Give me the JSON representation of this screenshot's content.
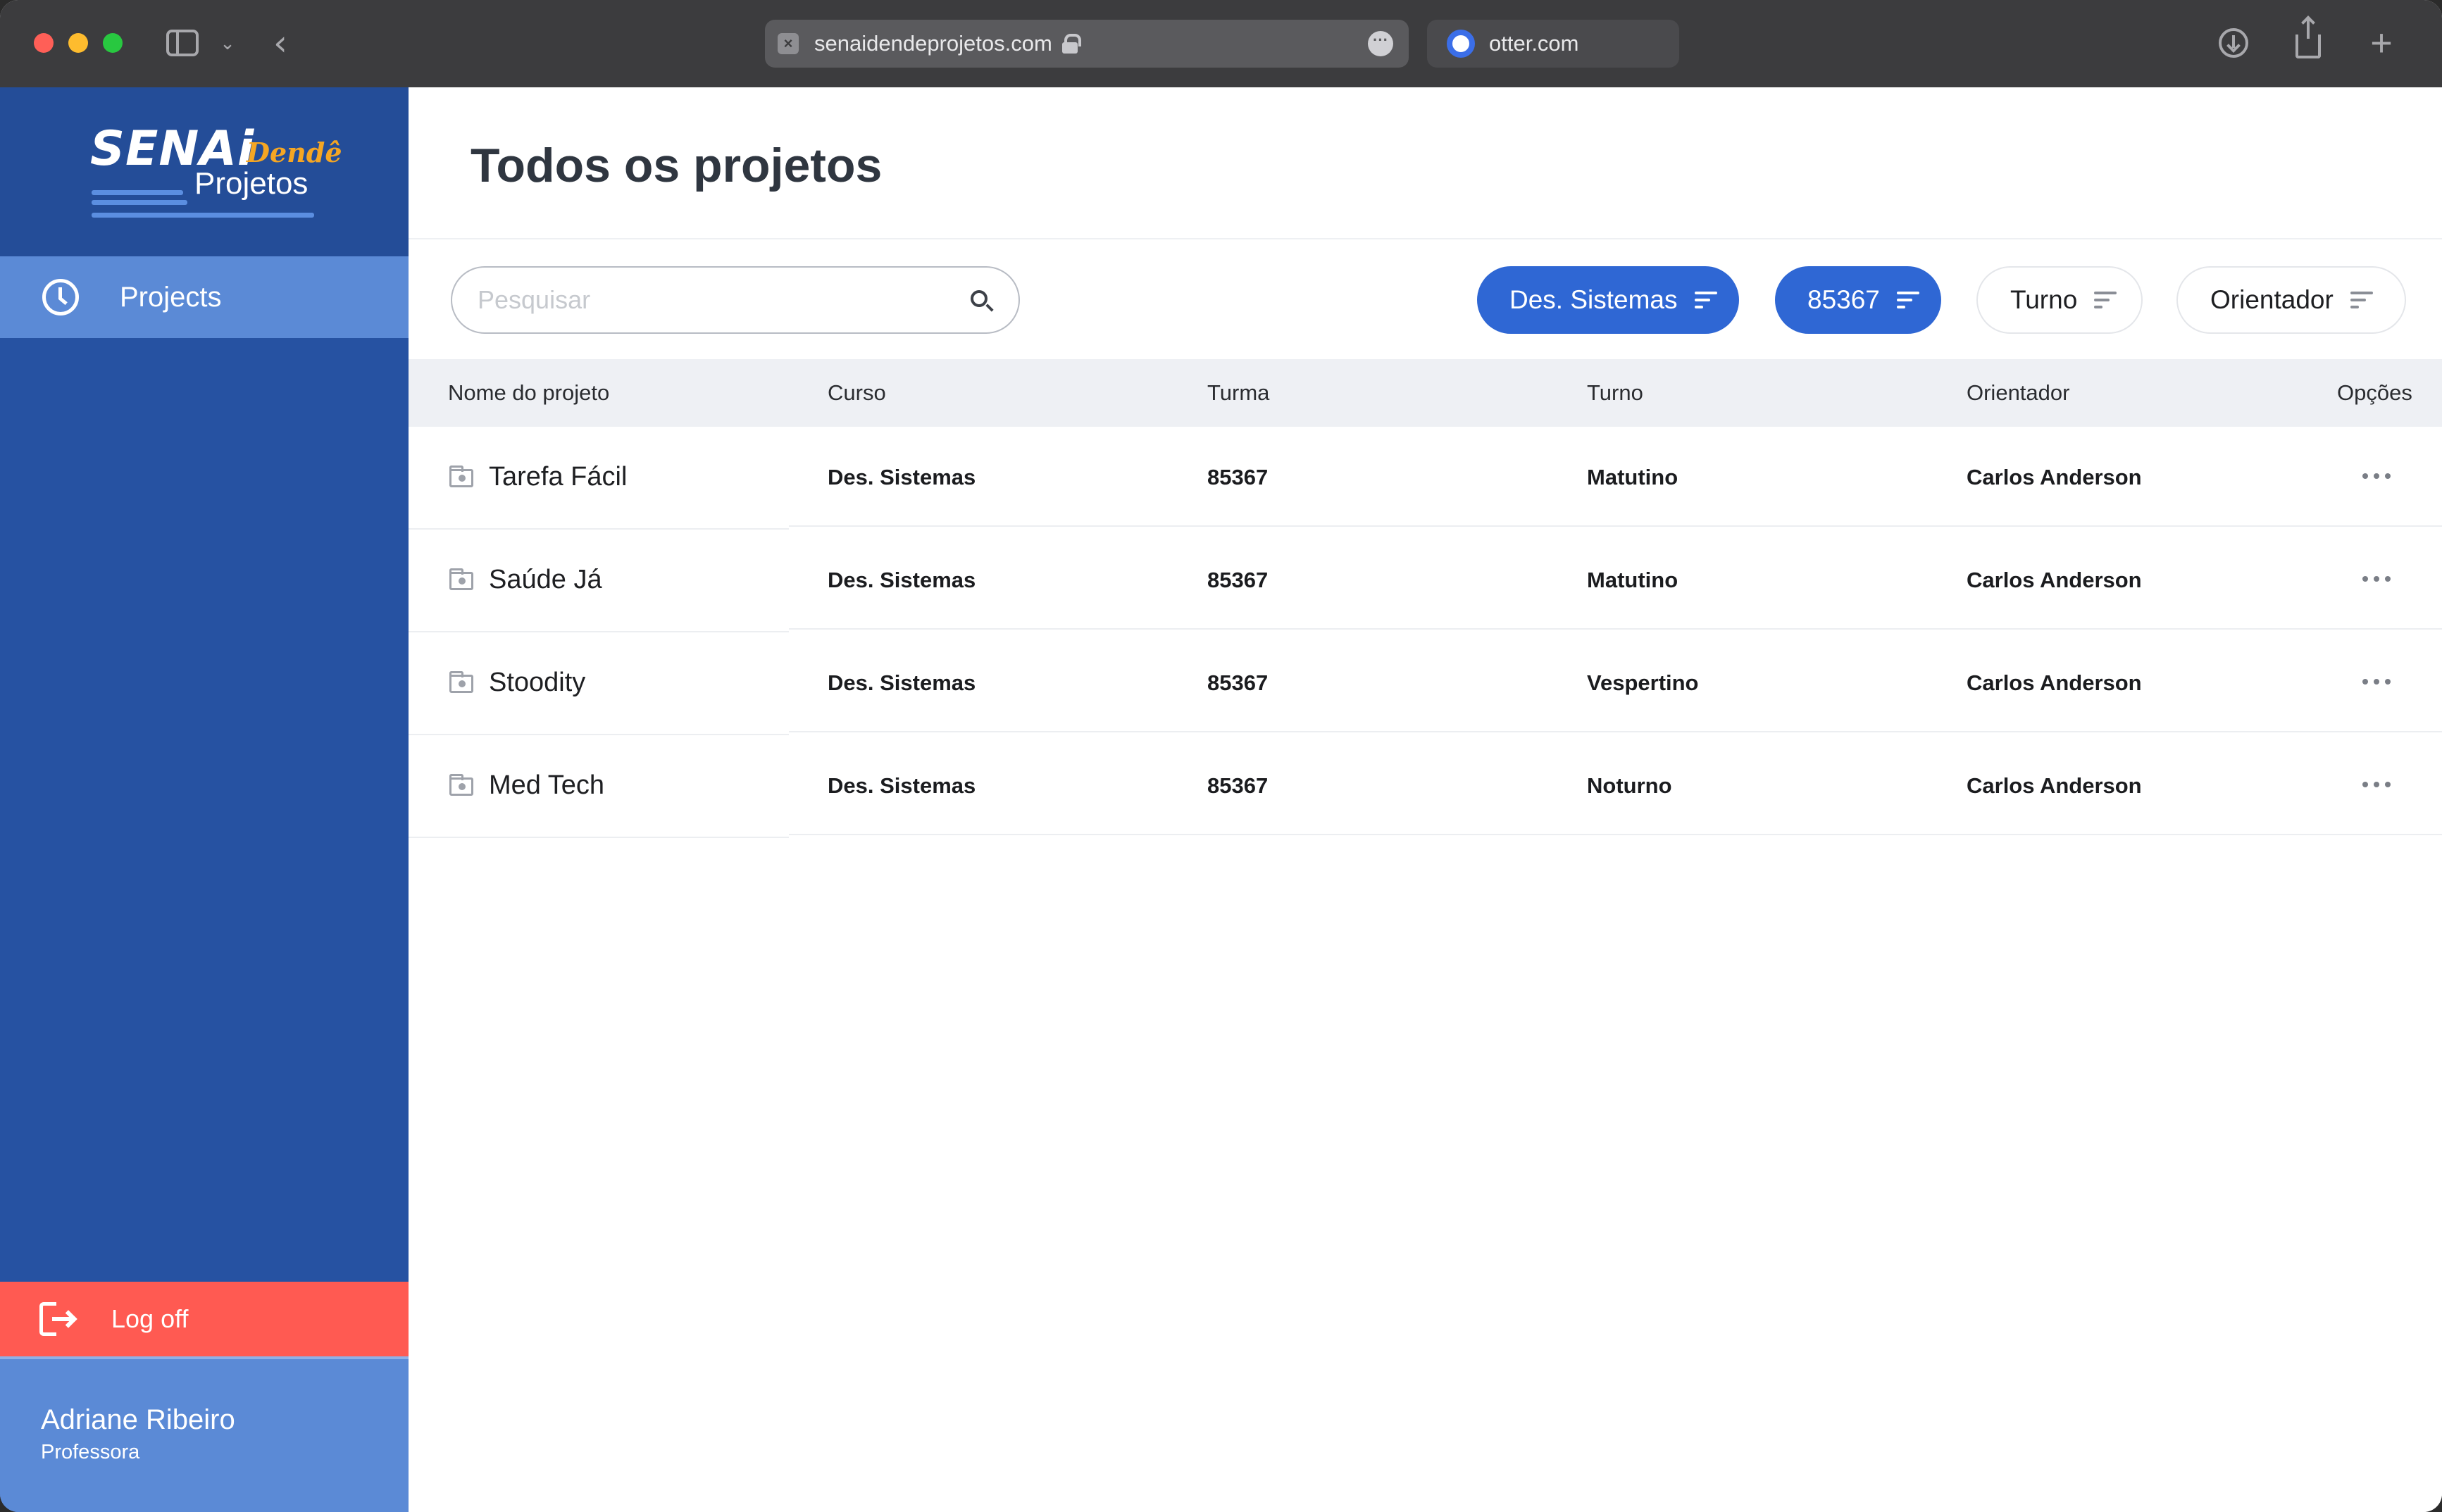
{
  "browser": {
    "active_tab_url": "senaidendeprojetos.com",
    "other_tab_url": "otter.com"
  },
  "sidebar": {
    "logo": {
      "line1": "SENAi",
      "line2": "Dendê",
      "line3": "Projetos"
    },
    "nav_items": [
      {
        "label": "Projects",
        "icon": "clock-icon",
        "active": true
      }
    ],
    "logoff_label": "Log off",
    "user": {
      "name": "Adriane Ribeiro",
      "role": "Professora"
    }
  },
  "main": {
    "title": "Todos os projetos",
    "search": {
      "placeholder": "Pesquisar",
      "value": ""
    },
    "filters": [
      {
        "label": "Des. Sistemas",
        "active": true
      },
      {
        "label": "85367",
        "active": true
      },
      {
        "label": "Turno",
        "active": false
      },
      {
        "label": "Orientador",
        "active": false
      }
    ],
    "table": {
      "headers": [
        "Nome do projeto",
        "Curso",
        "Turma",
        "Turno",
        "Orientador",
        "Opções"
      ],
      "rows": [
        {
          "name": "Tarefa Fácil",
          "curso": "Des. Sistemas",
          "turma": "85367",
          "turno": "Matutino",
          "orientador": "Carlos Anderson"
        },
        {
          "name": "Saúde Já",
          "curso": "Des. Sistemas",
          "turma": "85367",
          "turno": "Matutino",
          "orientador": "Carlos Anderson"
        },
        {
          "name": "Stoodity",
          "curso": "Des. Sistemas",
          "turma": "85367",
          "turno": "Vespertino",
          "orientador": "Carlos Anderson"
        },
        {
          "name": "Med Tech",
          "curso": "Des. Sistemas",
          "turma": "85367",
          "turno": "Noturno",
          "orientador": "Carlos Anderson"
        }
      ]
    }
  },
  "colors": {
    "sidebar_bg": "#2652a2",
    "sidebar_active": "#5b8ad6",
    "logoff_bg": "#ff5a52",
    "accent": "#2f67d4",
    "logo_orange": "#f5a623"
  }
}
